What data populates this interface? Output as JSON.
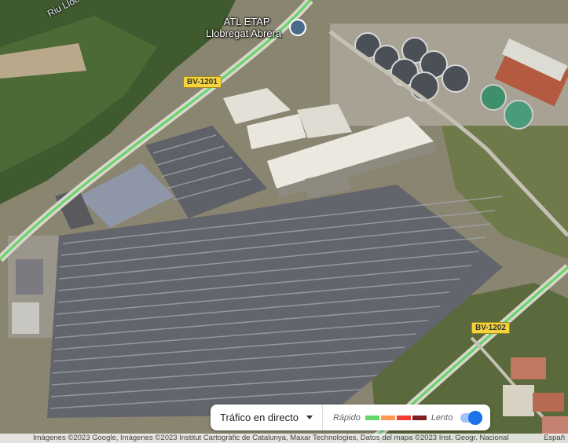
{
  "poi": {
    "name_line1": "ATL ETAP",
    "name_line2": "Llobregat Abrera",
    "icon": "museum-icon"
  },
  "river_label": "Riu Llobreg",
  "roads": {
    "bv1201": "BV-1201",
    "bv1202": "BV-1202"
  },
  "traffic": {
    "mode_label": "Tráfico en directo",
    "fast_label": "Rápido",
    "slow_label": "Lento",
    "colors": [
      "#63d668",
      "#ff974d",
      "#f23c32",
      "#811f1f"
    ],
    "toggle_on": true
  },
  "attribution": "Imágenes ©2023 Google, Imágenes ©2023 Institut Cartogràfic de Catalunya, Maxar Technologies, Datos del mapa ©2023 Inst. Geogr. Nacional",
  "attribution_right": "Españ"
}
